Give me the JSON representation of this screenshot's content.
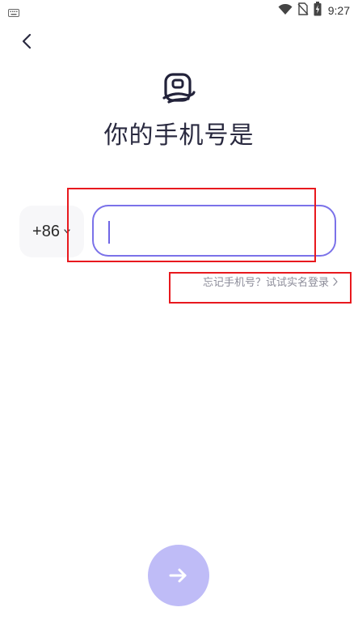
{
  "status_bar": {
    "time": "9:27",
    "icons": [
      "keyboard-icon",
      "wifi-icon",
      "no-sim-icon",
      "battery-charging-icon"
    ]
  },
  "header": {
    "back_icon": "chevron-left-icon",
    "logo_icon": "app-logo-icon"
  },
  "main": {
    "title": "你的手机号是",
    "country_code": "+86",
    "country_code_icon": "chevron-down-icon",
    "phone_input": {
      "value": "",
      "placeholder": ""
    },
    "forgot_link": "忘记手机号？试试实名登录",
    "forgot_link_icon": "chevron-right-icon"
  },
  "footer": {
    "next_icon": "arrow-right-icon"
  },
  "colors": {
    "accent": "#7b72e9",
    "next_button_disabled": "#bfbcf7",
    "annotation": "#e8191e",
    "country_bg": "#f7f7f9",
    "link_text": "#8c8c99"
  }
}
